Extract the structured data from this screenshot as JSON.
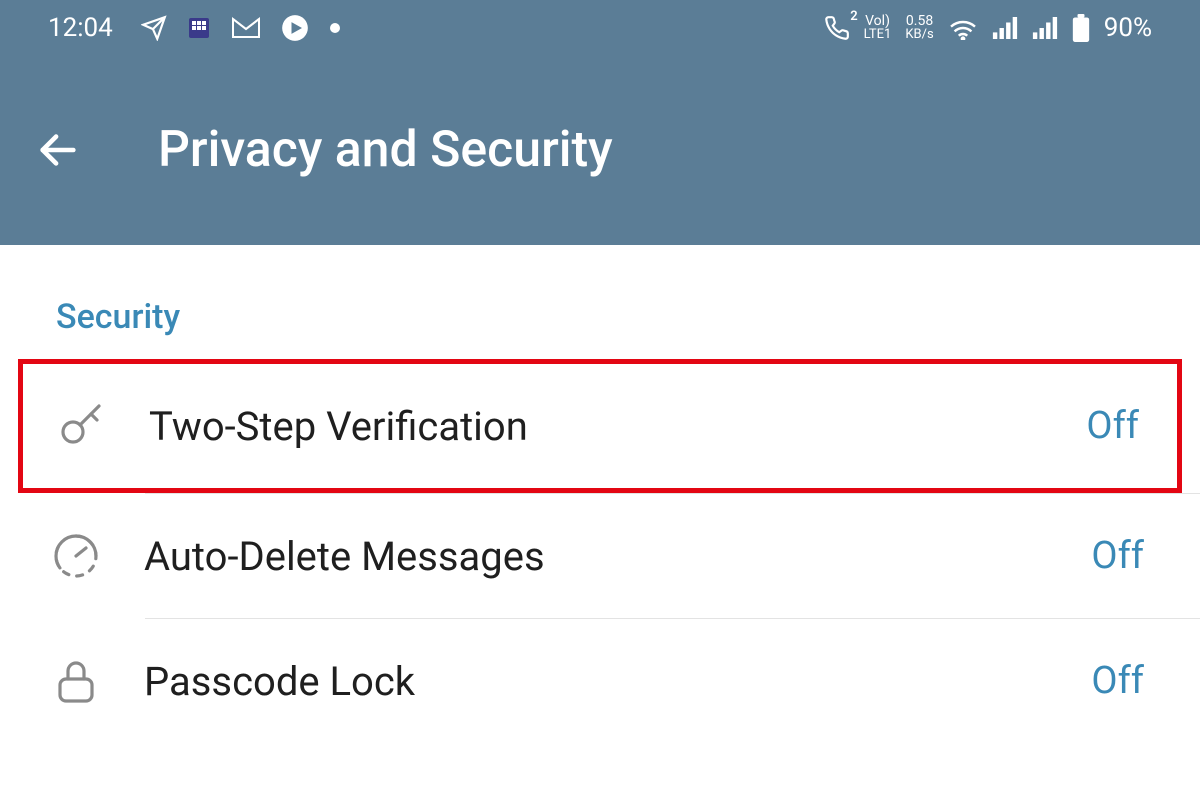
{
  "status": {
    "time": "12:04",
    "net": {
      "top": "Vol)",
      "bot": "LTE1"
    },
    "speed": {
      "top": "0.58",
      "bot": "KB/s"
    },
    "battery_pct": "90%",
    "phone_badge": "2"
  },
  "header": {
    "title": "Privacy and Security"
  },
  "section_label": "Security",
  "rows": [
    {
      "label": "Two-Step Verification",
      "value": "Off"
    },
    {
      "label": "Auto-Delete Messages",
      "value": "Off"
    },
    {
      "label": "Passcode Lock",
      "value": "Off"
    }
  ],
  "colors": {
    "header_bg": "#5b7d96",
    "accent": "#3a89b6",
    "highlight": "#e30613"
  }
}
